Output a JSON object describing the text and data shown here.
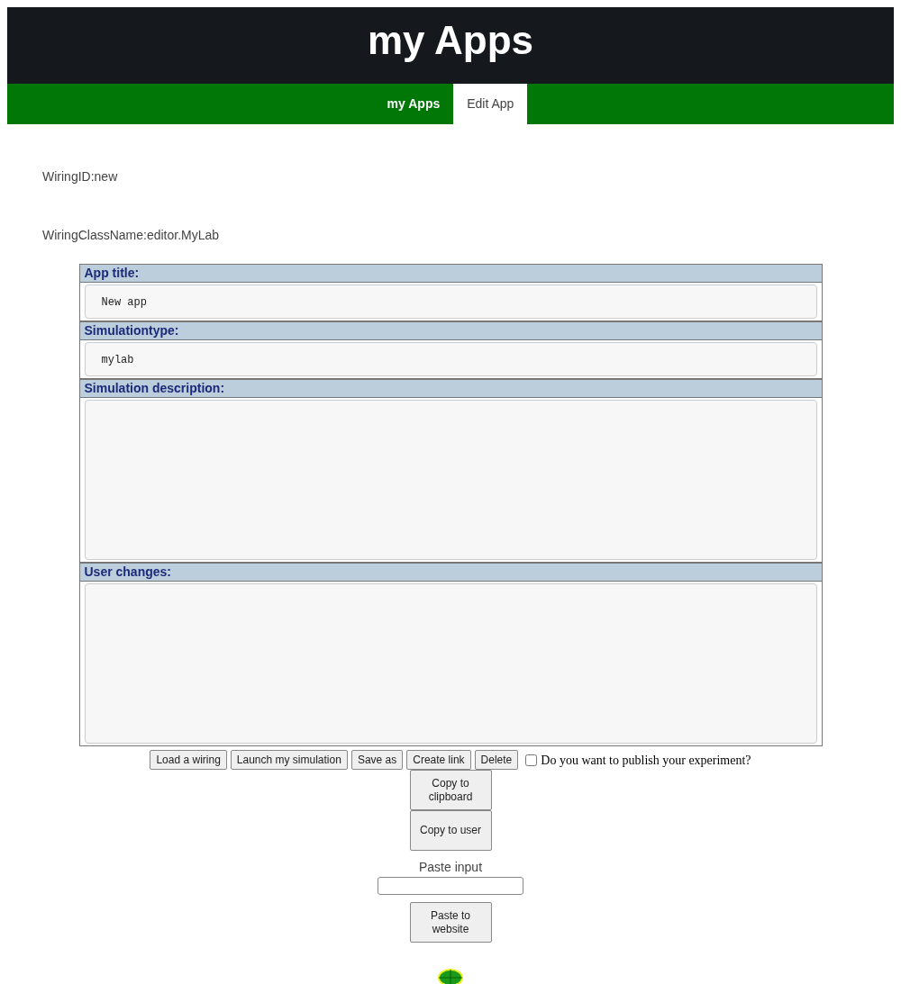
{
  "header": {
    "title": "my Apps"
  },
  "nav": [
    {
      "label": "my Apps",
      "selected": false
    },
    {
      "label": "Edit App",
      "selected": true
    }
  ],
  "info": [
    "WiringID:new",
    "WiringClassName:editor.MyLab"
  ],
  "fields": [
    {
      "label": "App title:",
      "kind": "line",
      "value": "New app"
    },
    {
      "label": "Simulationtype:",
      "kind": "line",
      "value": "mylab"
    },
    {
      "label": "Simulation description:",
      "kind": "area"
    },
    {
      "label": "User changes:",
      "kind": "area"
    }
  ],
  "actions": [
    "Load a wiring",
    "Launch my simulation",
    "Save as",
    "Create link",
    "Delete"
  ],
  "publish": {
    "label": "Do you want to publish your experiment?",
    "checked": false
  },
  "copy_buttons": [
    "Copy to clipboard",
    "Copy to user"
  ],
  "paste": {
    "label": "Paste input",
    "button": "Paste to website"
  }
}
